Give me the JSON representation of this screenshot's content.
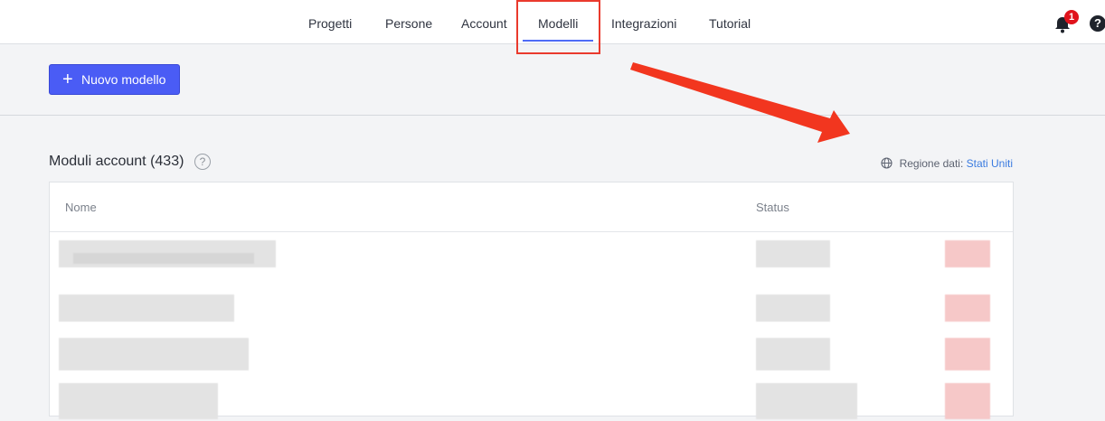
{
  "nav": {
    "items": [
      {
        "label": "Progetti"
      },
      {
        "label": "Persone"
      },
      {
        "label": "Account"
      },
      {
        "label": "Modelli",
        "active": true
      },
      {
        "label": "Integrazioni"
      },
      {
        "label": "Tutorial"
      }
    ],
    "notification_count": "1",
    "help_glyph": "?"
  },
  "toolbar": {
    "new_button_plus": "+",
    "new_button_label": "Nuovo modello"
  },
  "section": {
    "title": "Moduli account (433)",
    "help_glyph": "?",
    "region_label": "Regione dati:",
    "region_value": "Stati Uniti"
  },
  "table": {
    "columns": [
      "Nome",
      "Status"
    ]
  },
  "colors": {
    "accent": "#4a5cf5",
    "link": "#3a7be0",
    "annotation": "#ea3a2d",
    "badge": "#e0131c"
  },
  "icons": [
    "bell-icon",
    "help-icon",
    "plus-icon",
    "question-icon",
    "globe-icon",
    "arrow-annotation"
  ]
}
